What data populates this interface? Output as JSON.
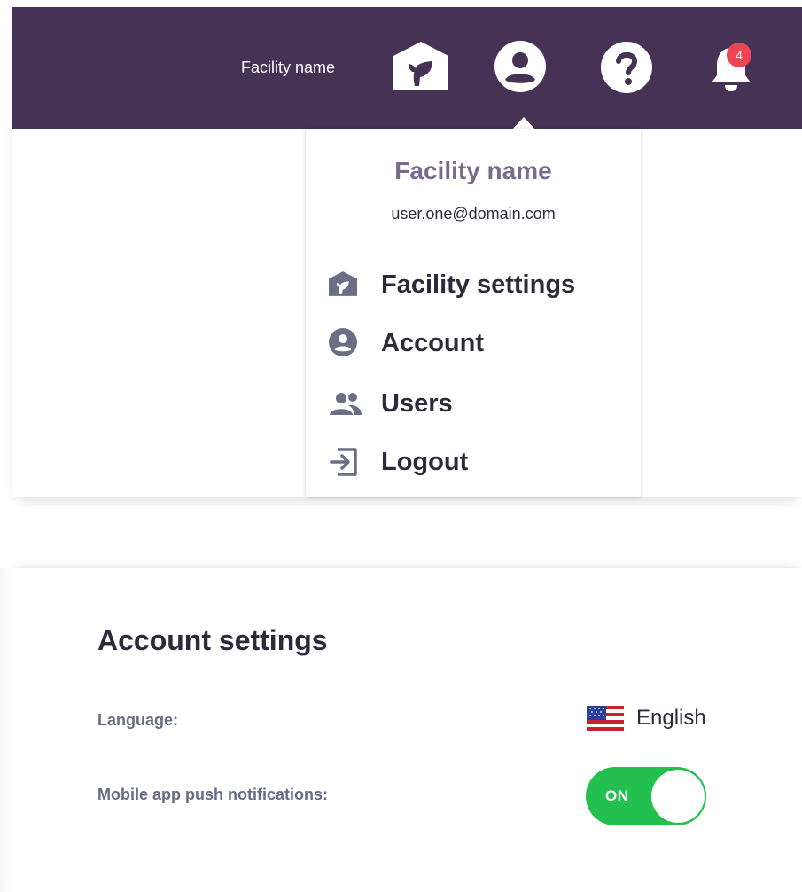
{
  "header": {
    "facility_label": "Facility name",
    "notification_count": "4",
    "colors": {
      "background": "#453254",
      "badge": "#ef4456"
    },
    "icons": [
      "facility-icon",
      "account-circle-icon",
      "help-icon",
      "bell-icon"
    ]
  },
  "dropdown": {
    "title": "Facility name",
    "email": "user.one@domain.com",
    "items": [
      {
        "label": "Facility settings",
        "icon": "facility-icon"
      },
      {
        "label": "Account",
        "icon": "account-circle-icon"
      },
      {
        "label": "Users",
        "icon": "users-icon"
      },
      {
        "label": "Logout",
        "icon": "logout-icon"
      }
    ]
  },
  "settings": {
    "title": "Account settings",
    "language_label": "Language:",
    "language_value": "English",
    "language_flag": "us-flag-icon",
    "push_label": "Mobile app push notifications:",
    "push_toggle_text": "ON",
    "push_enabled": true,
    "colors": {
      "toggle_on": "#23c04f"
    }
  }
}
